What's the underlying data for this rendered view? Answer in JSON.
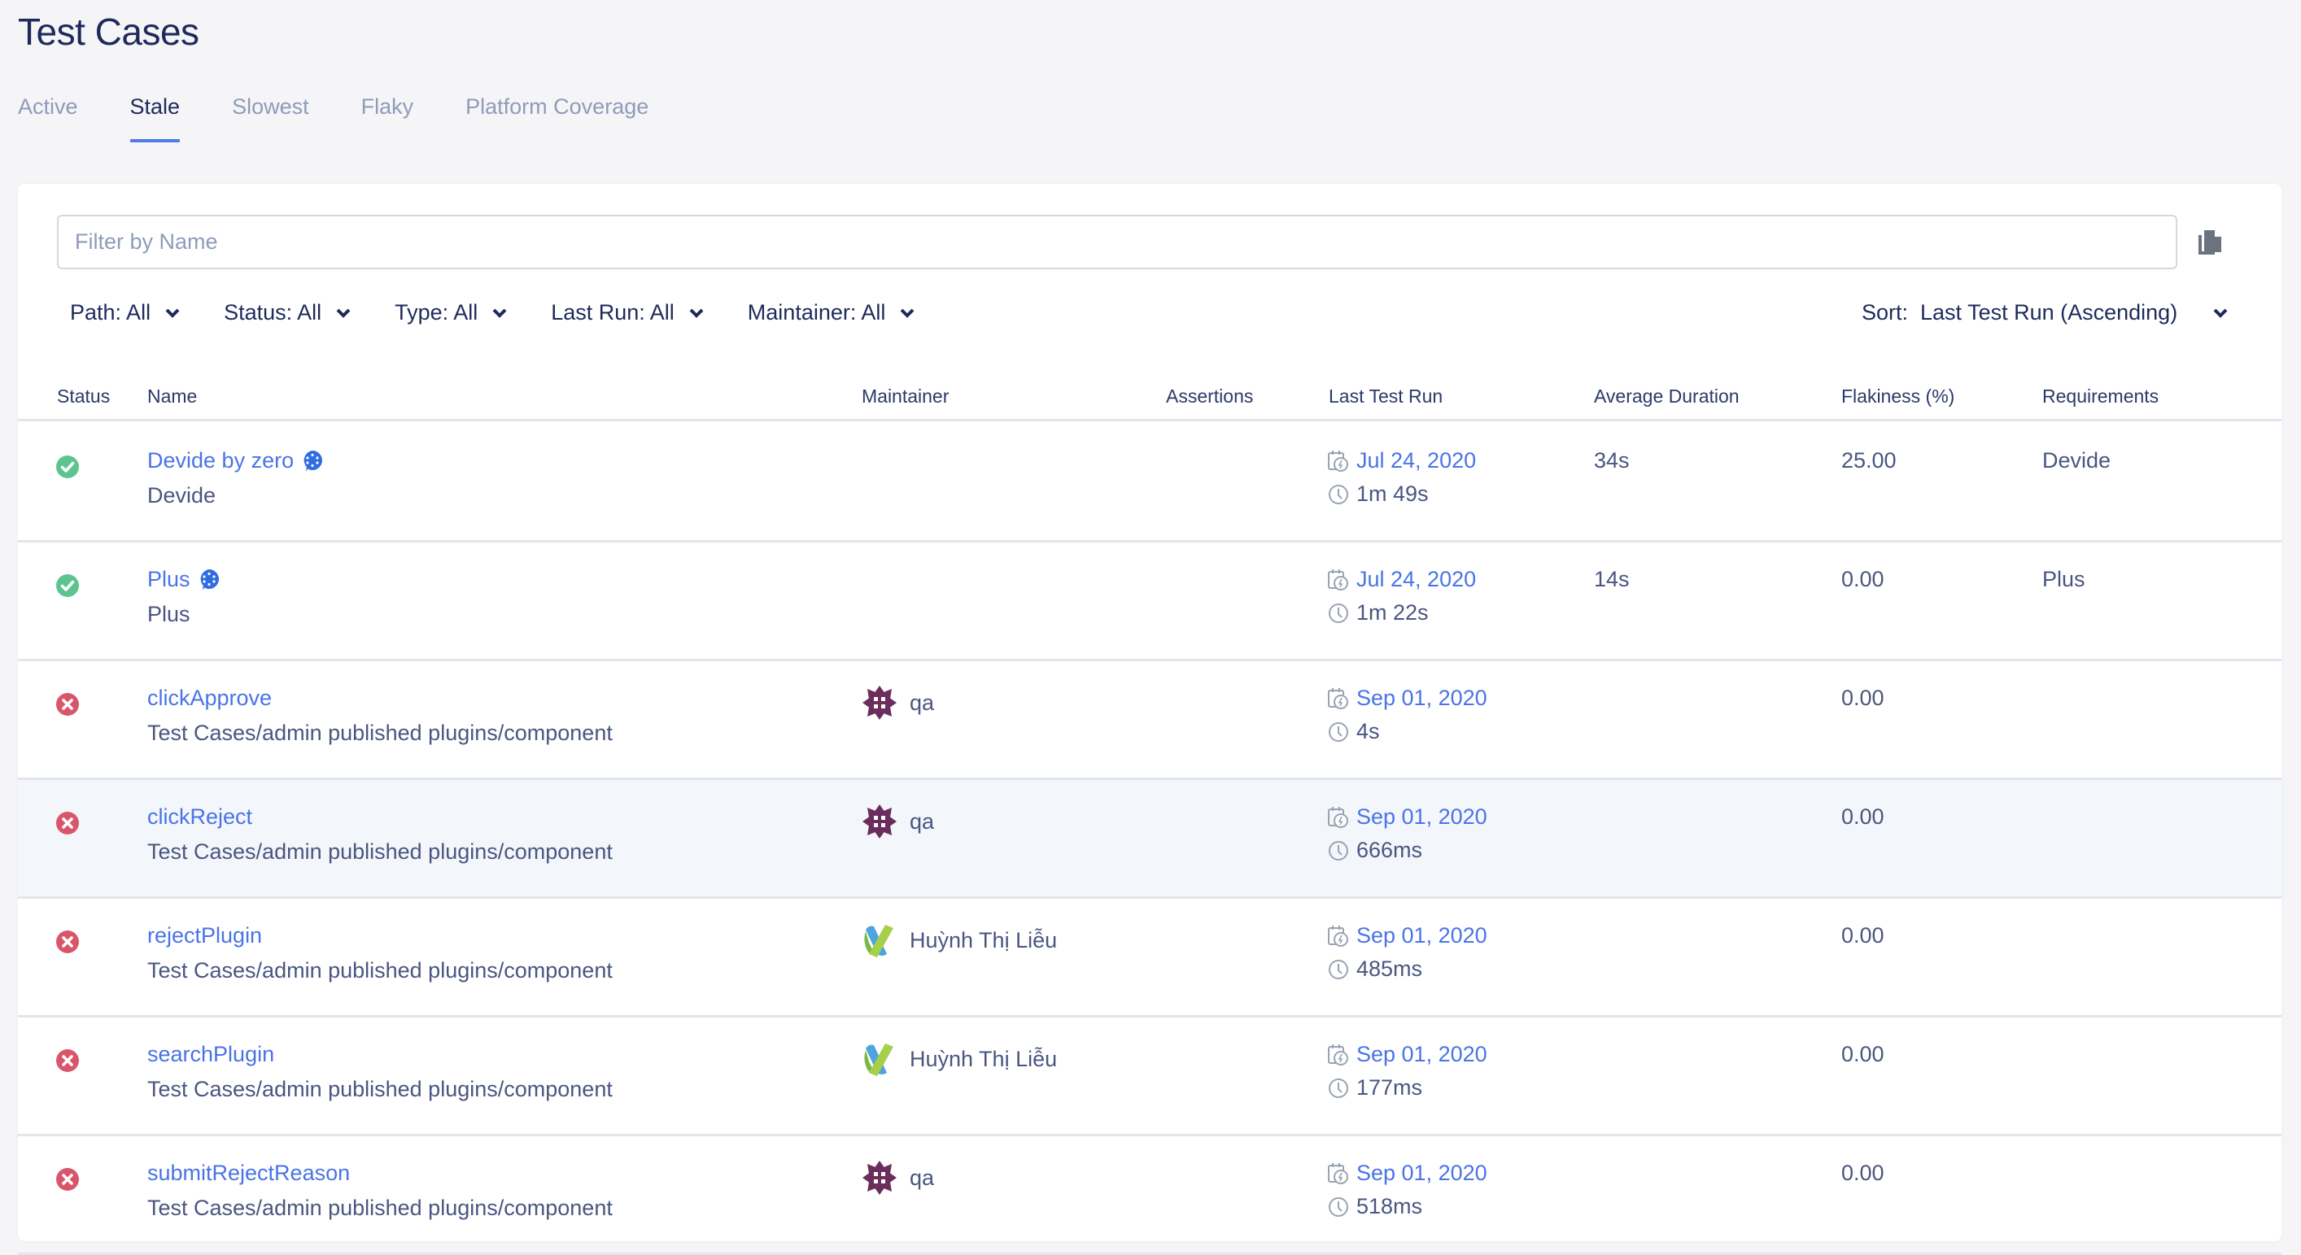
{
  "page": {
    "title": "Test Cases"
  },
  "tabs": [
    {
      "label": "Active",
      "active": false
    },
    {
      "label": "Stale",
      "active": true
    },
    {
      "label": "Slowest",
      "active": false
    },
    {
      "label": "Flaky",
      "active": false
    },
    {
      "label": "Platform Coverage",
      "active": false
    }
  ],
  "search": {
    "placeholder": "Filter by Name",
    "value": ""
  },
  "toolbar": {
    "copy_icon": "copy-documents-icon"
  },
  "filters": [
    {
      "label": "Path: All"
    },
    {
      "label": "Status: All"
    },
    {
      "label": "Type: All"
    },
    {
      "label": "Last Run: All"
    },
    {
      "label": "Maintainer: All"
    }
  ],
  "sort": {
    "label": "Sort:  Last Test Run (Ascending)"
  },
  "table": {
    "columns": [
      "Status",
      "Name",
      "Maintainer",
      "Assertions",
      "Last Test Run",
      "Average Duration",
      "Flakiness (%)",
      "Requirements"
    ],
    "rows": [
      {
        "status": "passed",
        "name": "Devide by zero",
        "cucumber": true,
        "path": "Devide",
        "maintainer": "",
        "avatar": "",
        "assertions": "",
        "last_run_date": "Jul 24, 2020",
        "last_run_duration": "1m 49s",
        "avg_duration": "34s",
        "flakiness": "25.00",
        "requirements": "Devide"
      },
      {
        "status": "passed",
        "name": "Plus",
        "cucumber": true,
        "path": "Plus",
        "maintainer": "",
        "avatar": "",
        "assertions": "",
        "last_run_date": "Jul 24, 2020",
        "last_run_duration": "1m 22s",
        "avg_duration": "14s",
        "flakiness": "0.00",
        "requirements": "Plus"
      },
      {
        "status": "failed",
        "name": "clickApprove",
        "cucumber": false,
        "path": "Test Cases/admin published plugins/component",
        "maintainer": "qa",
        "avatar": "purple-identicon",
        "assertions": "",
        "last_run_date": "Sep 01, 2020",
        "last_run_duration": "4s",
        "avg_duration": "",
        "flakiness": "0.00",
        "requirements": ""
      },
      {
        "status": "failed",
        "name": "clickReject",
        "cucumber": false,
        "path": "Test Cases/admin published plugins/component",
        "maintainer": "qa",
        "avatar": "purple-identicon",
        "assertions": "",
        "last_run_date": "Sep 01, 2020",
        "last_run_duration": "666ms",
        "avg_duration": "",
        "flakiness": "0.00",
        "requirements": "",
        "highlighted": true
      },
      {
        "status": "failed",
        "name": "rejectPlugin",
        "cucumber": false,
        "path": "Test Cases/admin published plugins/component",
        "maintainer": "Huỳnh Thị Liễu",
        "avatar": "green-blue-x-logo",
        "assertions": "",
        "last_run_date": "Sep 01, 2020",
        "last_run_duration": "485ms",
        "avg_duration": "",
        "flakiness": "0.00",
        "requirements": ""
      },
      {
        "status": "failed",
        "name": "searchPlugin",
        "cucumber": false,
        "path": "Test Cases/admin published plugins/component",
        "maintainer": "Huỳnh Thị Liễu",
        "avatar": "green-blue-x-logo",
        "assertions": "",
        "last_run_date": "Sep 01, 2020",
        "last_run_duration": "177ms",
        "avg_duration": "",
        "flakiness": "0.00",
        "requirements": ""
      },
      {
        "status": "failed",
        "name": "submitRejectReason",
        "cucumber": false,
        "path": "Test Cases/admin published plugins/component",
        "maintainer": "qa",
        "avatar": "purple-identicon",
        "assertions": "",
        "last_run_date": "Sep 01, 2020",
        "last_run_duration": "518ms",
        "avg_duration": "",
        "flakiness": "0.00",
        "requirements": ""
      }
    ]
  },
  "colors": {
    "accent": "#4f7ae8",
    "link": "#4a74e6",
    "passed": "#5cc48e",
    "failed": "#d9566a",
    "title": "#1e2a5a",
    "row_highlight": "#f3f6fb"
  }
}
